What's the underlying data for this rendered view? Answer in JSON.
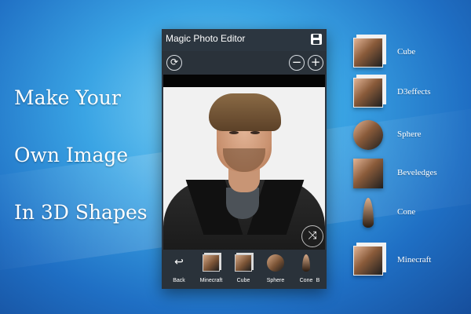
{
  "tagline": [
    "Make Your",
    "Own Image",
    "In 3D Shapes"
  ],
  "app": {
    "title": "Magic Photo Editor",
    "save_icon": "save-icon",
    "toolbar": {
      "refresh_icon": "refresh-icon",
      "zoom_out_glyph": "−",
      "zoom_in_glyph": "+",
      "refresh_glyph": "⟳"
    },
    "shuffle_glyph": "⤨",
    "shape_bar": {
      "back_glyph": "↩",
      "items": [
        {
          "label": "Back",
          "kind": "back"
        },
        {
          "label": "Minecraft",
          "kind": "cube"
        },
        {
          "label": "Cube",
          "kind": "cube"
        },
        {
          "label": "Sphere",
          "kind": "sphere"
        },
        {
          "label": "Cone",
          "kind": "cone"
        },
        {
          "label": "B",
          "kind": "cube"
        }
      ]
    }
  },
  "side_shapes": [
    {
      "label": "Cube",
      "kind": "cube"
    },
    {
      "label": "D3effects",
      "kind": "cube"
    },
    {
      "label": "Sphere",
      "kind": "sphere"
    },
    {
      "label": "Beveledges",
      "kind": "plain"
    },
    {
      "label": "Cone",
      "kind": "cone"
    },
    {
      "label": "Minecraft",
      "kind": "cube"
    }
  ],
  "colors": {
    "background": "#2f8fd8",
    "app_bar": "#2c3640",
    "text": "#ffffff"
  }
}
